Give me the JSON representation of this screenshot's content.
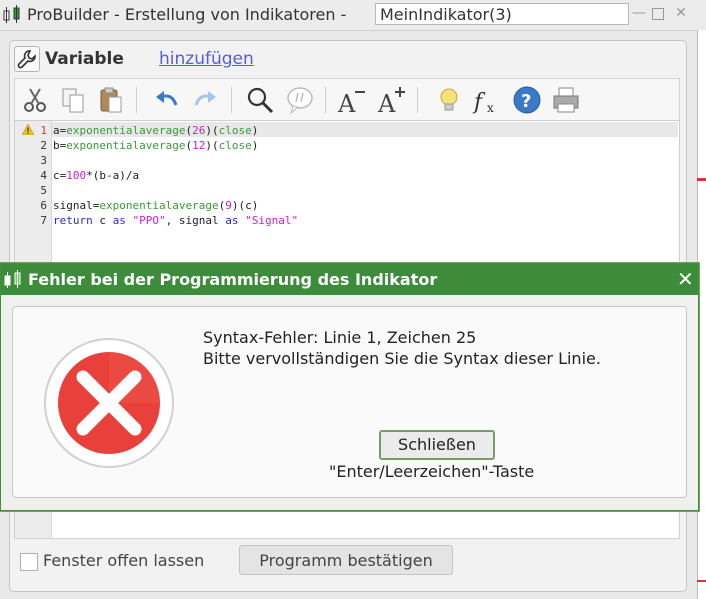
{
  "window": {
    "title": "ProBuilder -  Erstellung von Indikatoren -",
    "title_field": "MeinIndikator(3)"
  },
  "variable": {
    "label": "Variable",
    "add_link": "hinzufügen"
  },
  "toolbar": {
    "icons": [
      "scissors-icon",
      "copy-icon",
      "paste-icon",
      "undo-icon",
      "redo-icon",
      "search-icon",
      "comment-icon",
      "font-decrease-icon",
      "font-increase-icon",
      "lightbulb-icon",
      "function-icon",
      "help-icon",
      "print-icon"
    ]
  },
  "editor": {
    "lines": [
      {
        "num": "1",
        "error": true,
        "tokens": [
          [
            "plain",
            "a="
          ],
          [
            "fn",
            "exponentialaverage"
          ],
          [
            "plain",
            "("
          ],
          [
            "num",
            "26"
          ],
          [
            "plain",
            ")"
          ],
          [
            "plain",
            "("
          ],
          [
            "fn",
            "close"
          ],
          [
            "plain",
            ")"
          ]
        ]
      },
      {
        "num": "2",
        "error": false,
        "tokens": [
          [
            "plain",
            "b="
          ],
          [
            "fn",
            "exponentialaverage"
          ],
          [
            "plain",
            "("
          ],
          [
            "num",
            "12"
          ],
          [
            "plain",
            ")("
          ],
          [
            "fn",
            "close"
          ],
          [
            "plain",
            ")"
          ]
        ]
      },
      {
        "num": "3",
        "error": false,
        "tokens": []
      },
      {
        "num": "4",
        "error": false,
        "tokens": [
          [
            "plain",
            "c="
          ],
          [
            "num",
            "100"
          ],
          [
            "plain",
            "*(b-a)/a"
          ]
        ]
      },
      {
        "num": "5",
        "error": false,
        "tokens": []
      },
      {
        "num": "6",
        "error": false,
        "tokens": [
          [
            "plain",
            "signal="
          ],
          [
            "fn",
            "exponentialaverage"
          ],
          [
            "plain",
            "("
          ],
          [
            "num",
            "9"
          ],
          [
            "plain",
            ")(c)"
          ]
        ]
      },
      {
        "num": "7",
        "error": false,
        "tokens": [
          [
            "kw",
            "return"
          ],
          [
            "plain",
            " c "
          ],
          [
            "kw",
            "as"
          ],
          [
            "plain",
            " "
          ],
          [
            "str",
            "\"PPO\""
          ],
          [
            "plain",
            ", signal "
          ],
          [
            "kw",
            "as"
          ],
          [
            "plain",
            " "
          ],
          [
            "str",
            "\"Signal\""
          ]
        ]
      }
    ]
  },
  "footer": {
    "keep_open_label": "Fenster offen lassen",
    "confirm_button": "Programm bestätigen"
  },
  "dialog": {
    "title": "Fehler bei der Programmierung des Indikator",
    "message_line1": "Syntax-Fehler: Linie 1, Zeichen 25",
    "message_line2": "Bitte vervollständigen Sie die Syntax dieser Linie.",
    "close_button": "Schließen",
    "close_hint": "\"Enter/Leerzeichen\"-Taste"
  },
  "colors": {
    "dialog_title_bg": "#3c8c3c",
    "error_red": "#e8403a",
    "link_blue": "#5a5ae0"
  }
}
